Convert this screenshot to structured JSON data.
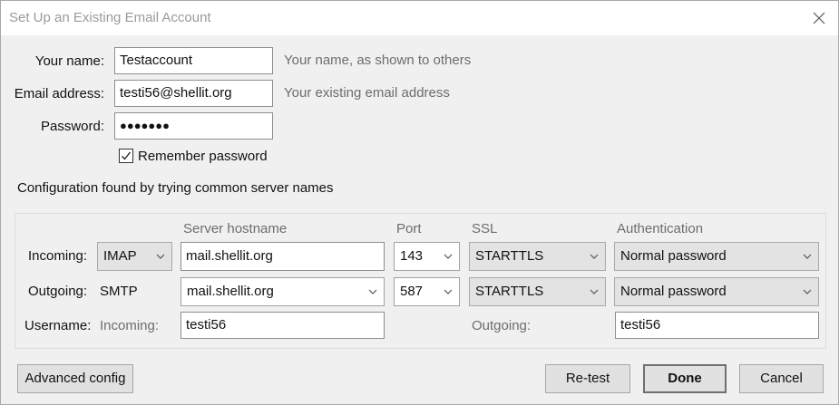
{
  "window": {
    "title": "Set Up an Existing Email Account"
  },
  "identity": {
    "name_label": "Your name:",
    "name_value": "Testaccount",
    "name_hint": "Your name, as shown to others",
    "email_label": "Email address:",
    "email_value": "testi56@shellit.org",
    "email_hint": "Your existing email address",
    "password_label": "Password:",
    "password_value": "●●●●●●●",
    "remember_label": "Remember password",
    "remember_checked": true
  },
  "status": "Configuration found by trying common server names",
  "servers": {
    "headers": {
      "hostname": "Server hostname",
      "port": "Port",
      "ssl": "SSL",
      "auth": "Authentication"
    },
    "incoming": {
      "label": "Incoming:",
      "protocol": "IMAP",
      "hostname": "mail.shellit.org",
      "port": "143",
      "ssl": "STARTTLS",
      "auth": "Normal password"
    },
    "outgoing": {
      "label": "Outgoing:",
      "protocol": "SMTP",
      "hostname": "mail.shellit.org",
      "port": "587",
      "ssl": "STARTTLS",
      "auth": "Normal password"
    },
    "username": {
      "label": "Username:",
      "incoming_label": "Incoming:",
      "incoming_value": "testi56",
      "outgoing_label": "Outgoing:",
      "outgoing_value": "testi56"
    }
  },
  "buttons": {
    "advanced": "Advanced config",
    "retest": "Re-test",
    "done": "Done",
    "cancel": "Cancel"
  }
}
